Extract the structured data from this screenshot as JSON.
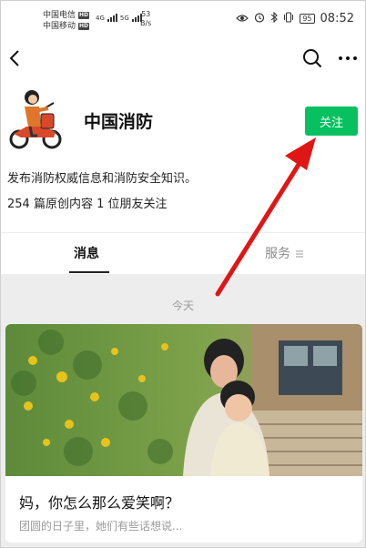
{
  "status_bar": {
    "carrier_1": "中国电信",
    "carrier_2": "中国移动",
    "hd_badge": "HD",
    "network_type": "4G",
    "network_type_2": "5G",
    "speed_value": "53",
    "speed_unit": "B/s",
    "battery": "95",
    "time": "08:52"
  },
  "nav": {
    "back_icon": "chevron-left-icon",
    "search_icon": "search-icon",
    "more_icon": "more-horizontal-icon"
  },
  "profile": {
    "name": "中国消防",
    "follow_label": "关注",
    "bio": "发布消防权威信息和消防安全知识。",
    "stats": "254 篇原创内容  1 位朋友关注"
  },
  "tabs": {
    "messages": "消息",
    "services": "服务"
  },
  "feed": {
    "date_label": "今天",
    "article": {
      "title": "妈，你怎么那么爱笑啊？",
      "summary": "团圆的日子里，她们有些话想说..."
    }
  },
  "colors": {
    "accent_green": "#07c160",
    "annotation_arrow": "#e01616"
  }
}
